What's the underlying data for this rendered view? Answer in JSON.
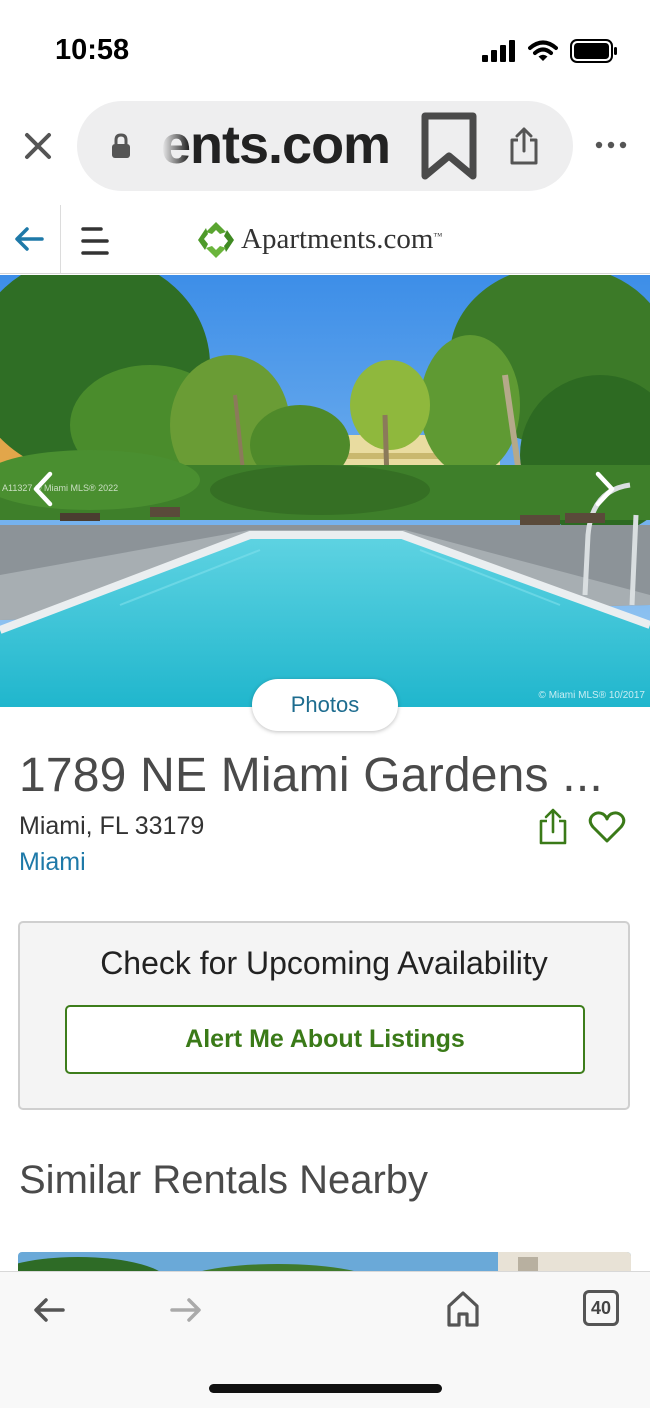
{
  "status_bar": {
    "time": "10:58"
  },
  "browser": {
    "url_text": "ents.com",
    "icons": [
      "close-icon",
      "lock-icon",
      "bookmark-icon",
      "share-icon",
      "more-icon"
    ]
  },
  "site_header": {
    "logo_text": "Apartments.com",
    "logo_tm": "™",
    "icons": [
      "back-arrow-icon",
      "hamburger-menu-icon",
      "apartments-logo-icon"
    ],
    "brand_color": "#4e9a2a"
  },
  "hero": {
    "watermark_left": "A11327 © Miami MLS® 2022",
    "watermark_right": "© Miami MLS® 10/2017",
    "photos_button": "Photos"
  },
  "property": {
    "title": "1789 NE Miami Gardens ...",
    "address": "Miami, FL 33179",
    "city_link": "Miami"
  },
  "availability": {
    "title": "Check for Upcoming Availability",
    "alert_button": "Alert Me About Listings"
  },
  "similar": {
    "heading": "Similar Rentals Nearby"
  },
  "bottom_bar": {
    "tab_count": "40"
  },
  "colors": {
    "link_blue": "#1e79a8",
    "accent_green": "#3a7a18",
    "photos_blue": "#1d6c8f"
  }
}
